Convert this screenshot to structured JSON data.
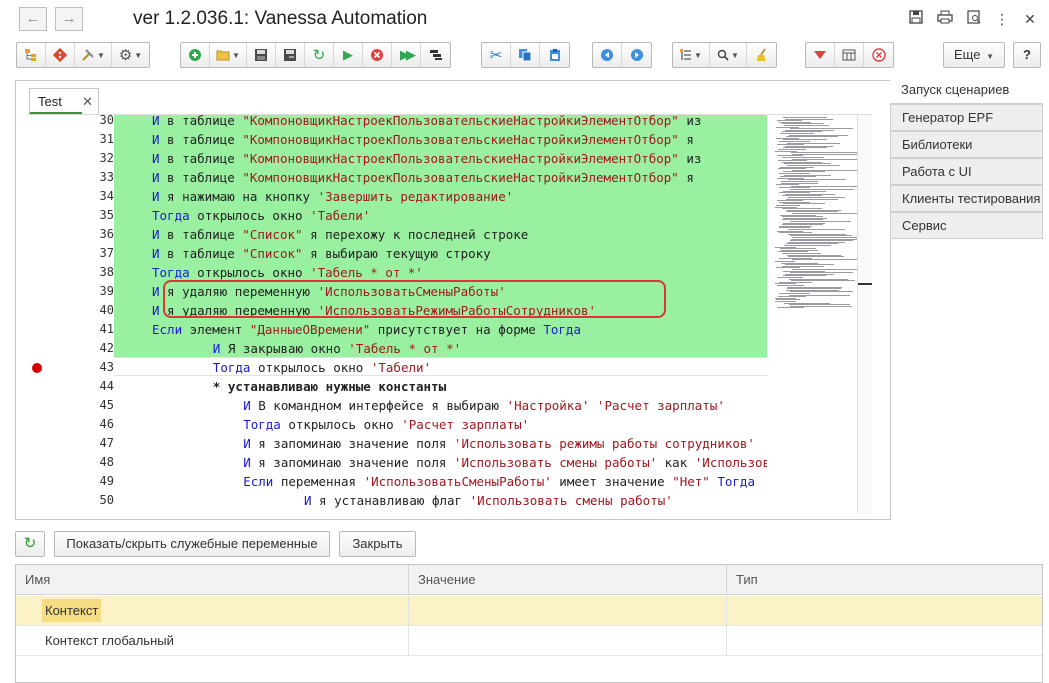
{
  "window": {
    "title": "ver 1.2.036.1: Vanessa Automation",
    "nav_back": "←",
    "nav_forward": "→"
  },
  "toolbar": {
    "more_label": "Еще",
    "help_label": "?"
  },
  "editor": {
    "tab_label": "Test",
    "tab_close": "✕",
    "lines": [
      {
        "n": "30",
        "indent": 5,
        "parts": [
          [
            "kw",
            "И"
          ],
          [
            "t",
            " в таблице "
          ],
          [
            "str",
            "\"КомпоновщикНастроекПользовательскиеНастройкиЭлементОтбор\""
          ],
          [
            "t",
            " из"
          ]
        ]
      },
      {
        "n": "31",
        "indent": 5,
        "parts": [
          [
            "kw",
            "И"
          ],
          [
            "t",
            " в таблице "
          ],
          [
            "str",
            "\"КомпоновщикНастроекПользовательскиеНастройкиЭлементОтбор\""
          ],
          [
            "t",
            " я"
          ]
        ]
      },
      {
        "n": "32",
        "indent": 5,
        "parts": [
          [
            "kw",
            "И"
          ],
          [
            "t",
            " в таблице "
          ],
          [
            "str",
            "\"КомпоновщикНастроекПользовательскиеНастройкиЭлементОтбор\""
          ],
          [
            "t",
            " из"
          ]
        ]
      },
      {
        "n": "33",
        "indent": 5,
        "parts": [
          [
            "kw",
            "И"
          ],
          [
            "t",
            " в таблице "
          ],
          [
            "str",
            "\"КомпоновщикНастроекПользовательскиеНастройкиЭлементОтбор\""
          ],
          [
            "t",
            " я"
          ]
        ]
      },
      {
        "n": "34",
        "indent": 5,
        "parts": [
          [
            "kw",
            "И"
          ],
          [
            "t",
            " я нажимаю на кнопку "
          ],
          [
            "str",
            "'Завершить редактирование'"
          ]
        ]
      },
      {
        "n": "35",
        "indent": 5,
        "parts": [
          [
            "kw",
            "Тогда"
          ],
          [
            "t",
            " открылось окно "
          ],
          [
            "str",
            "'Табели'"
          ]
        ]
      },
      {
        "n": "36",
        "indent": 5,
        "parts": [
          [
            "kw",
            "И"
          ],
          [
            "t",
            " в таблице "
          ],
          [
            "str",
            "\"Список\""
          ],
          [
            "t",
            " я перехожу к последней строке"
          ]
        ]
      },
      {
        "n": "37",
        "indent": 5,
        "parts": [
          [
            "kw",
            "И"
          ],
          [
            "t",
            " в таблице "
          ],
          [
            "str",
            "\"Список\""
          ],
          [
            "t",
            " я выбираю текущую строку"
          ]
        ]
      },
      {
        "n": "38",
        "indent": 5,
        "parts": [
          [
            "kw",
            "Тогда"
          ],
          [
            "t",
            " открылось окно "
          ],
          [
            "str",
            "'Табель * от *'"
          ]
        ]
      },
      {
        "n": "39",
        "indent": 5,
        "parts": [
          [
            "kw",
            "И"
          ],
          [
            "t",
            " я удаляю переменную "
          ],
          [
            "str",
            "'ИспользоватьСменыРаботы'"
          ]
        ]
      },
      {
        "n": "40",
        "indent": 5,
        "parts": [
          [
            "kw",
            "И"
          ],
          [
            "t",
            " я удаляю переменную "
          ],
          [
            "str",
            "'ИспользоватьРежимыРаботыСотрудников'"
          ]
        ]
      },
      {
        "n": "41",
        "indent": 5,
        "parts": [
          [
            "kw",
            "Если"
          ],
          [
            "t",
            " элемент "
          ],
          [
            "str",
            "\"ДанныеОВремени\""
          ],
          [
            "t",
            " присутствует на форме "
          ],
          [
            "kw",
            "Тогда"
          ]
        ]
      },
      {
        "n": "42",
        "indent": 13,
        "parts": [
          [
            "kw",
            "И"
          ],
          [
            "t",
            " Я закрываю окно "
          ],
          [
            "str",
            "'Табель * от *'"
          ]
        ]
      },
      {
        "n": "43",
        "indent": 13,
        "parts": [
          [
            "kw",
            "Тогда"
          ],
          [
            "t",
            " открылось окно "
          ],
          [
            "str",
            "'Табели'"
          ]
        ]
      },
      {
        "n": "44",
        "indent": 13,
        "parts": [
          [
            "b",
            "* устанавливаю нужные константы"
          ]
        ]
      },
      {
        "n": "45",
        "indent": 17,
        "parts": [
          [
            "kw",
            "И"
          ],
          [
            "t",
            " В командном интерфейсе я выбираю "
          ],
          [
            "str",
            "'Настройка'"
          ],
          [
            "t",
            " "
          ],
          [
            "str",
            "'Расчет зарплаты'"
          ]
        ]
      },
      {
        "n": "46",
        "indent": 17,
        "parts": [
          [
            "kw",
            "Тогда"
          ],
          [
            "t",
            " открылось окно "
          ],
          [
            "str",
            "'Расчет зарплаты'"
          ]
        ]
      },
      {
        "n": "47",
        "indent": 17,
        "parts": [
          [
            "kw",
            "И"
          ],
          [
            "t",
            " я запоминаю значение поля "
          ],
          [
            "str",
            "'Использовать режимы работы сотрудников'"
          ]
        ]
      },
      {
        "n": "48",
        "indent": 17,
        "parts": [
          [
            "kw",
            "И"
          ],
          [
            "t",
            " я запоминаю значение поля "
          ],
          [
            "str",
            "'Использовать смены работы'"
          ],
          [
            "t",
            " как "
          ],
          [
            "str",
            "'ИспользоватьСменыРаботы'"
          ]
        ]
      },
      {
        "n": "49",
        "indent": 17,
        "parts": [
          [
            "kw",
            "Если"
          ],
          [
            "t",
            " переменная "
          ],
          [
            "str",
            "'ИспользоватьСменыРаботы'"
          ],
          [
            "t",
            " имеет значение "
          ],
          [
            "str",
            "\"Нет\""
          ],
          [
            "t",
            " "
          ],
          [
            "kw",
            "Тогда"
          ]
        ]
      },
      {
        "n": "50",
        "indent": 25,
        "parts": [
          [
            "kw",
            "И"
          ],
          [
            "t",
            " я устанавливаю флаг "
          ],
          [
            "str",
            "'Использовать смены работы'"
          ]
        ]
      }
    ]
  },
  "side_panel": {
    "items": [
      {
        "label": "Запуск сценариев",
        "active": true
      },
      {
        "label": "Генератор EPF",
        "active": false
      },
      {
        "label": "Библиотеки",
        "active": false
      },
      {
        "label": "Работа с UI",
        "active": false
      },
      {
        "label": "Клиенты тестирования",
        "active": false
      },
      {
        "label": "Сервис",
        "active": false
      }
    ]
  },
  "variables_bar": {
    "toggle_label": "Показать/скрыть служебные переменные",
    "close_label": "Закрыть"
  },
  "variables_table": {
    "columns": [
      "Имя",
      "Значение",
      "Тип"
    ],
    "rows": [
      {
        "name": "Контекст",
        "value": "",
        "type": ""
      },
      {
        "name": "Контекст глобальный",
        "value": "",
        "type": ""
      }
    ]
  }
}
